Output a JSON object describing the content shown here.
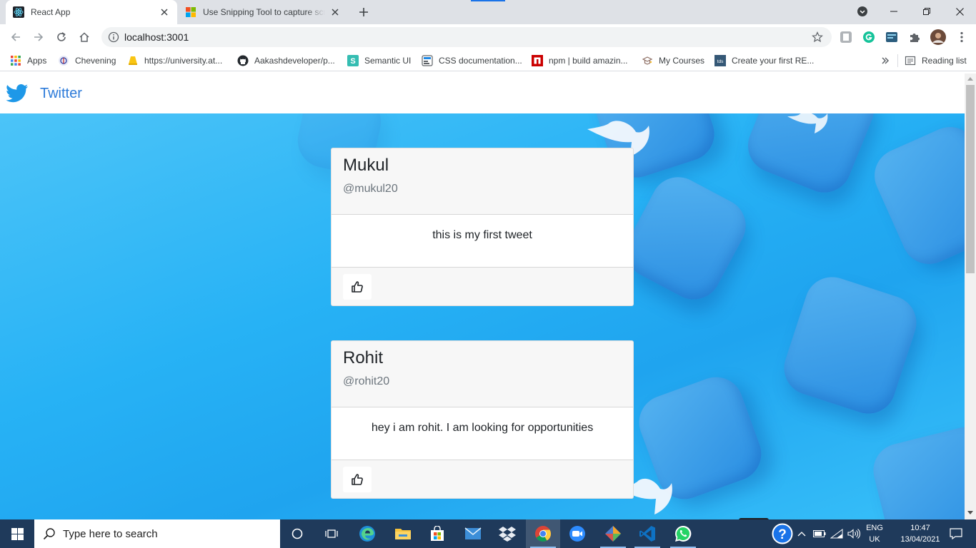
{
  "browser": {
    "tabs": [
      {
        "title": "React App",
        "favicon": "react-icon"
      },
      {
        "title": "Use Snipping Tool to capture scre",
        "favicon": "microsoft-icon"
      }
    ],
    "url": "localhost:3001"
  },
  "bookmarks": [
    {
      "label": "Apps",
      "icon": "apps-grid-icon"
    },
    {
      "label": "Chevening",
      "icon": "chevening-icon"
    },
    {
      "label": "https://university.at...",
      "icon": "folder-icon"
    },
    {
      "label": "Aakashdeveloper/p...",
      "icon": "github-icon"
    },
    {
      "label": "Semantic UI",
      "icon": "semantic-ui-icon"
    },
    {
      "label": "CSS documentation...",
      "icon": "css-icon"
    },
    {
      "label": "npm | build amazin...",
      "icon": "npm-icon"
    },
    {
      "label": "My Courses",
      "icon": "courses-icon"
    },
    {
      "label": "Create your first RE...",
      "icon": "tds-icon"
    }
  ],
  "reading_list": "Reading list",
  "page": {
    "brand": "Twitter",
    "tweets": [
      {
        "name": "Mukul",
        "handle": "@mukul20",
        "text": "this is my first tweet"
      },
      {
        "name": "Rohit",
        "handle": "@rohit20",
        "text": "hey i am rohit. I am looking for opportunities"
      }
    ]
  },
  "taskbar": {
    "search_placeholder": "Type here to search",
    "lang_line1": "ENG",
    "lang_line2": "UK",
    "time": "10:47",
    "date": "13/04/2021"
  },
  "colors": {
    "brand": "#2d7bd9",
    "hero": "#27b2f5",
    "taskbar": "#1f3a5b",
    "fab": "#1d1d1f"
  }
}
